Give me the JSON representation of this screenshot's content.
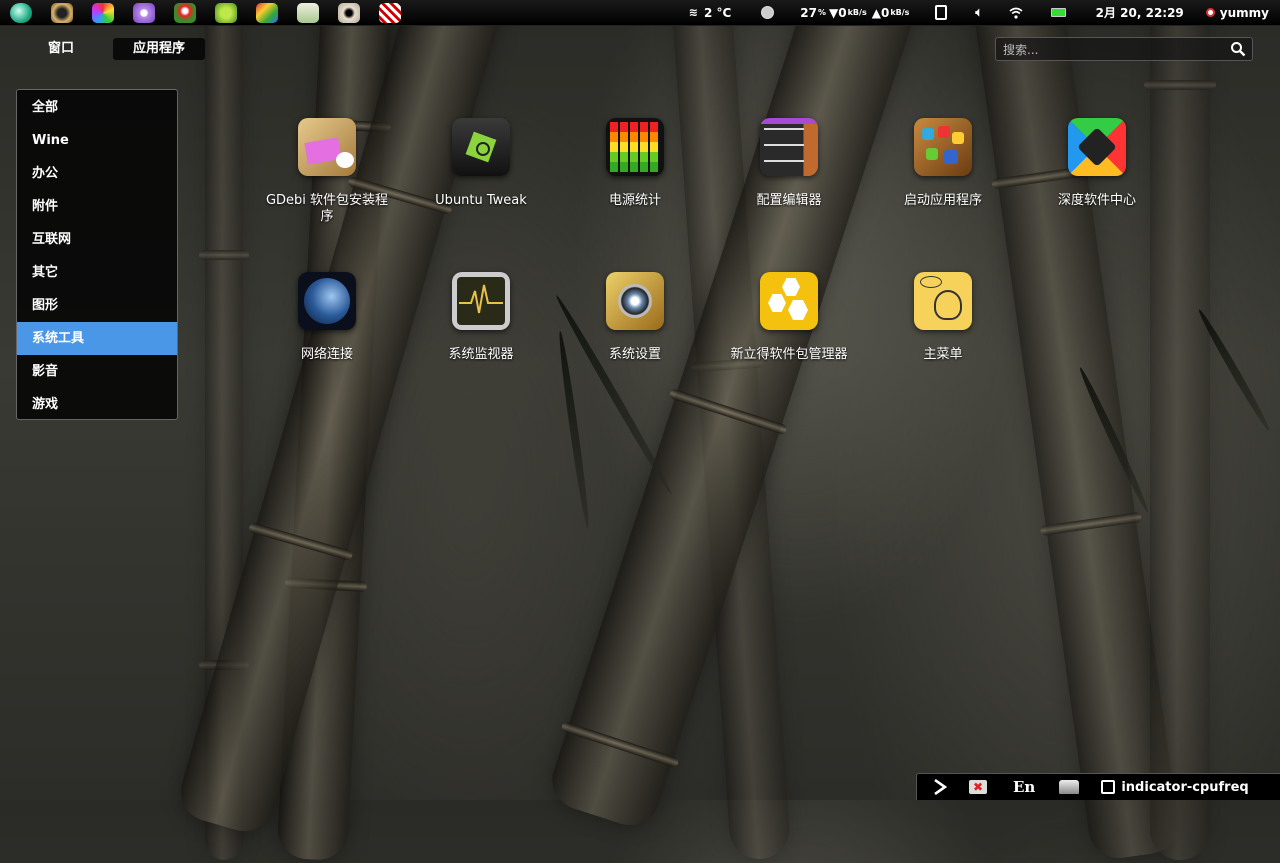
{
  "top_panel": {
    "dock_icons": [
      "deepin-icon",
      "scanner-icon",
      "paint-icon",
      "chat-icon",
      "game-icon",
      "android-icon",
      "cannabis-icon",
      "notes-icon",
      "paw-icon",
      "zebra-icon"
    ],
    "weather": "2 °C",
    "cpu": "27",
    "cpu_unit": "%",
    "net_down": "0",
    "net_down_unit": "kB/s",
    "net_up": "0",
    "net_up_unit": "kB/s",
    "datetime": "2月 20, 22:29",
    "user": "yummy"
  },
  "nav": {
    "windows_label": "窗口",
    "apps_label": "应用程序"
  },
  "search": {
    "placeholder": "搜索..."
  },
  "categories": [
    {
      "label": "全部"
    },
    {
      "label": "Wine"
    },
    {
      "label": "办公"
    },
    {
      "label": "附件"
    },
    {
      "label": "互联网"
    },
    {
      "label": "其它"
    },
    {
      "label": "图形"
    },
    {
      "label": "系统工具",
      "active": true
    },
    {
      "label": "影音"
    },
    {
      "label": "游戏"
    }
  ],
  "apps": [
    {
      "label": "GDebi 软件包安装程序",
      "icon": "package-icon"
    },
    {
      "label": "Ubuntu Tweak",
      "icon": "tweak-icon"
    },
    {
      "label": "电源统计",
      "icon": "power-stats-icon"
    },
    {
      "label": "配置编辑器",
      "icon": "config-editor-icon"
    },
    {
      "label": "启动应用程序",
      "icon": "startup-apps-icon"
    },
    {
      "label": "深度软件中心",
      "icon": "software-center-icon"
    },
    {
      "label": "网络连接",
      "icon": "globe-icon"
    },
    {
      "label": "系统监视器",
      "icon": "system-monitor-icon"
    },
    {
      "label": "系统设置",
      "icon": "settings-icon"
    },
    {
      "label": "新立得软件包管理器",
      "icon": "synaptic-icon"
    },
    {
      "label": "主菜单",
      "icon": "main-menu-icon"
    }
  ],
  "bottom_tray": {
    "lang": "En",
    "indicator": "indicator-cpufreq"
  },
  "colors": {
    "accent": "#4a97e8",
    "battery": "#33dd33"
  }
}
